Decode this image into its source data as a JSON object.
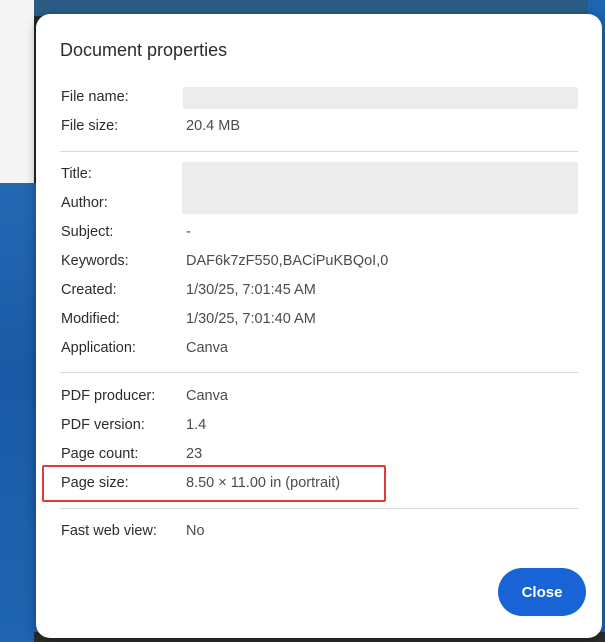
{
  "dialog": {
    "title": "Document properties",
    "file": {
      "name_label": "File name:",
      "size_label": "File size:",
      "size_value": "20.4 MB"
    },
    "description": {
      "title_label": "Title:",
      "author_label": "Author:",
      "subject_label": "Subject:",
      "subject_value": "-",
      "keywords_label": "Keywords:",
      "keywords_value": "DAF6k7zF550,BACiPuKBQoI,0",
      "created_label": "Created:",
      "created_value": "1/30/25, 7:01:45 AM",
      "modified_label": "Modified:",
      "modified_value": "1/30/25, 7:01:40 AM",
      "application_label": "Application:",
      "application_value": "Canva"
    },
    "pdf": {
      "producer_label": "PDF producer:",
      "producer_value": "Canva",
      "version_label": "PDF version:",
      "version_value": "1.4",
      "page_count_label": "Page count:",
      "page_count_value": "23",
      "page_size_label": "Page size:",
      "page_size_value": "8.50 × 11.00 in (portrait)"
    },
    "web": {
      "fast_web_view_label": "Fast web view:",
      "fast_web_view_value": "No"
    },
    "close_label": "Close"
  },
  "colors": {
    "primary_button": "#1863d6",
    "highlight_border": "#e03a3a"
  }
}
